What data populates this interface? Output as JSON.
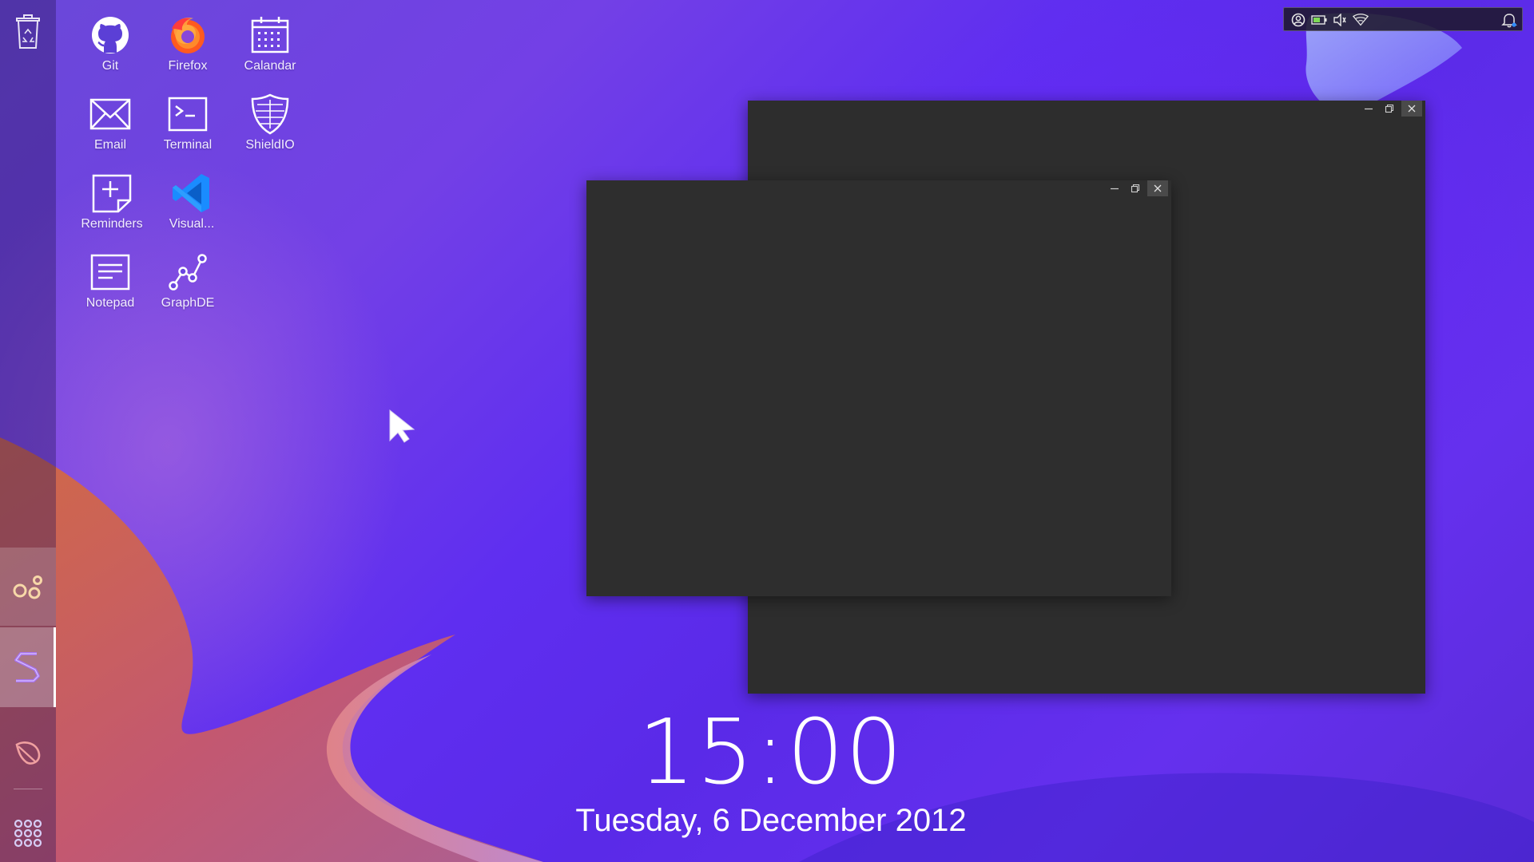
{
  "desktop": {
    "icons": [
      {
        "label": "Git",
        "icon": "github-icon"
      },
      {
        "label": "Firefox",
        "icon": "firefox-icon"
      },
      {
        "label": "Calandar",
        "icon": "calendar-icon"
      },
      {
        "label": "Email",
        "icon": "email-icon"
      },
      {
        "label": "Terminal",
        "icon": "terminal-icon"
      },
      {
        "label": "ShieldIO",
        "icon": "shield-icon"
      },
      {
        "label": "Reminders",
        "icon": "reminder-note-icon"
      },
      {
        "label": "Visual...",
        "icon": "vscode-icon"
      },
      {
        "label": "Notepad",
        "icon": "notepad-icon"
      },
      {
        "label": "GraphDE",
        "icon": "graph-icon"
      }
    ]
  },
  "dock": {
    "items": [
      {
        "icon": "recycle-bin-icon"
      },
      {
        "icon": "gears-icon"
      },
      {
        "icon": "s-logo-icon"
      },
      {
        "icon": "leaf-icon"
      },
      {
        "icon": "app-grid-icon"
      }
    ]
  },
  "tray": {
    "icons": [
      "user-icon",
      "battery-icon",
      "volume-icon",
      "wifi-icon",
      "notification-bell-icon"
    ]
  },
  "windows": [
    {
      "title": ""
    },
    {
      "title": ""
    }
  ],
  "clock": {
    "time": "15:00",
    "date": "Tuesday, 6 December 2012"
  },
  "colors": {
    "accent_orange": "#e06a3a",
    "window_bg": "#2d2d2d",
    "vscode_blue": "#1a8cff"
  }
}
